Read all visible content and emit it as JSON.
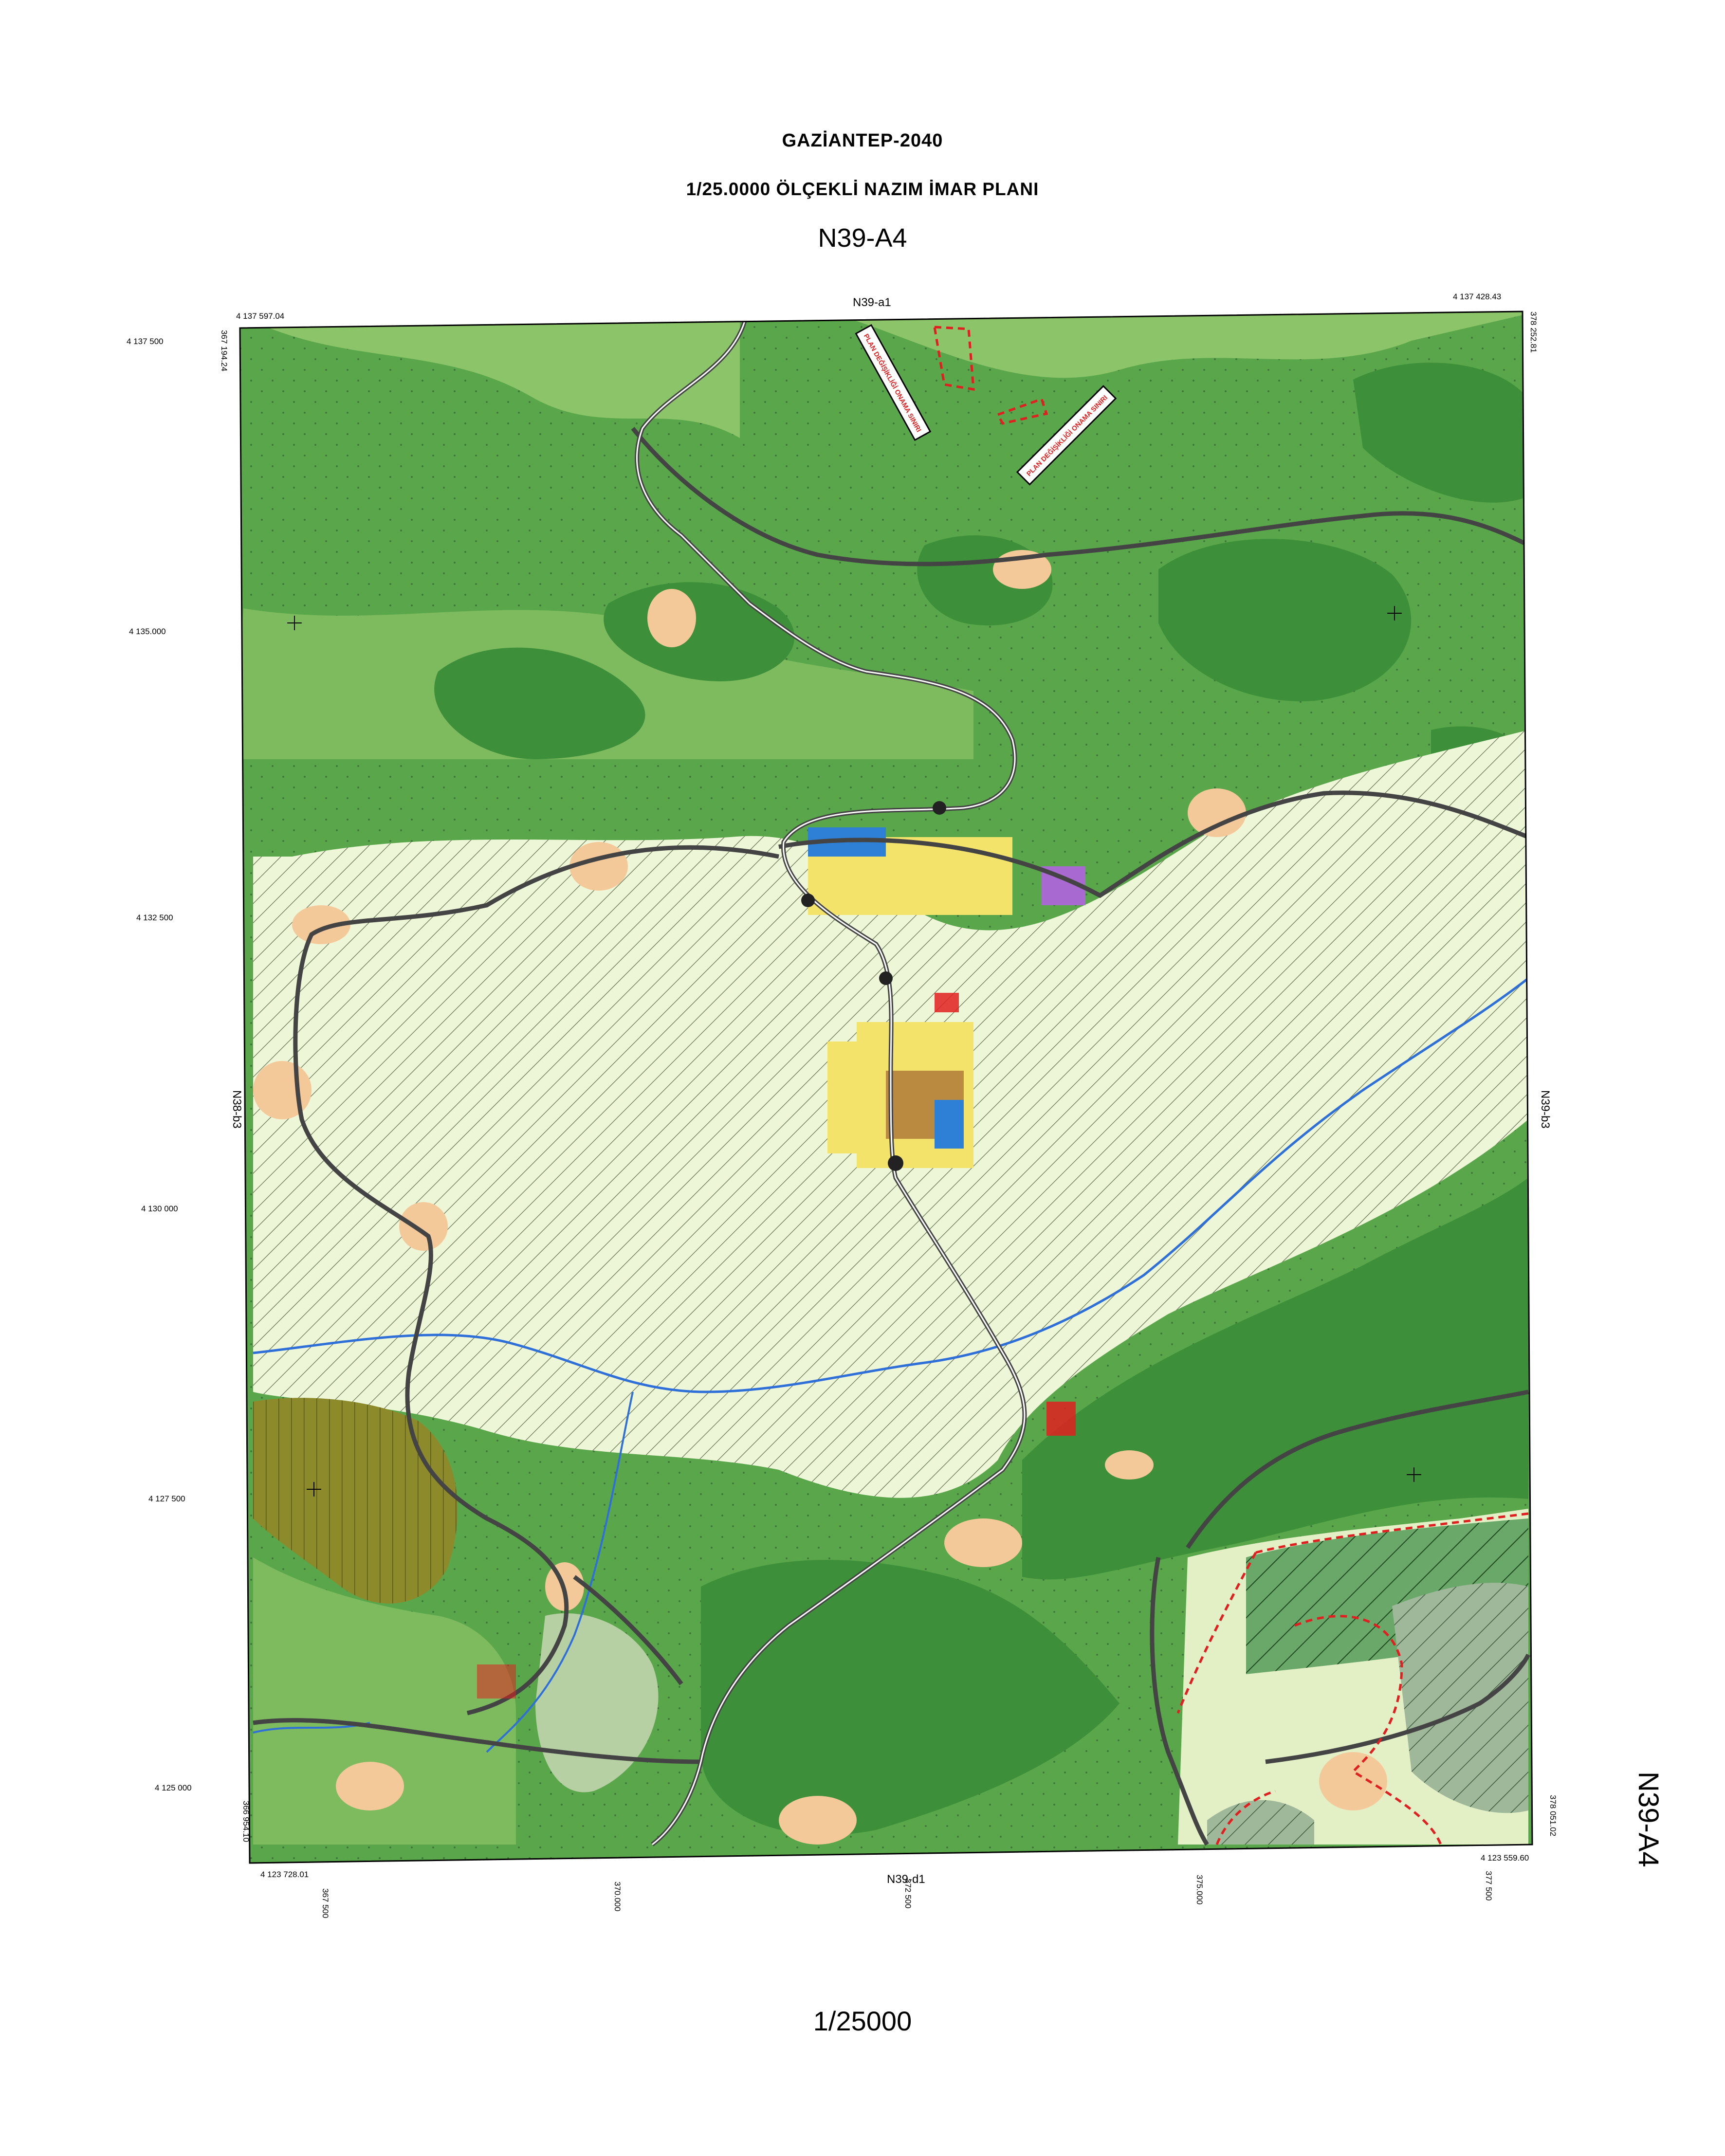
{
  "header": {
    "title": "GAZİANTEP-2040",
    "subtitle": "1/25.0000 ÖLÇEKLİ NAZIM İMAR PLANI",
    "sheet_code": "N39-A4"
  },
  "footer": {
    "scale": "1/25000",
    "side_sheet_code": "N39-A4"
  },
  "adjacent_sheets": {
    "top": "N39-a1",
    "bottom": "N39-d1",
    "left": "N38-b3",
    "right": "N39-b3"
  },
  "corners": {
    "top_left_northing": "4 137 597.04",
    "top_right_northing": "4 137 428.43",
    "bottom_left_northing": "4 123 728.01",
    "bottom_right_northing": "4 123 559.60",
    "top_left_easting": "367 194.24",
    "top_right_easting": "378 252.81",
    "bottom_left_easting": "366 954.10",
    "bottom_right_easting": "378 051.02"
  },
  "grid_northings": [
    "4 137 500",
    "4 135.000",
    "4 132 500",
    "4 130 000",
    "4 127 500",
    "4 125 000"
  ],
  "grid_eastings": [
    "367 500",
    "370.000",
    "372 500",
    "375.000",
    "377 500"
  ],
  "legend_callouts": [
    "PLAN DEĞİŞİKLİĞİ ONAMA SINIRI",
    "PLAN DEĞİŞİKLİĞİ ONAMA SINIRI"
  ],
  "colors": {
    "forest_dark": "#3d8f3a",
    "forest_mid": "#5aa64a",
    "forest_light": "#8cc46a",
    "agriculture": "#e3f0c6",
    "agri_hatch": "#f1f7de",
    "olive_area": "#8c8a2a",
    "settlement": "#f3c99a",
    "residential": "#f4e36a",
    "public": "#2e7fd6",
    "commercial": "#a86ad0",
    "road": "#444444",
    "river": "#2f6fd8",
    "plan_boundary": "#e02020"
  }
}
